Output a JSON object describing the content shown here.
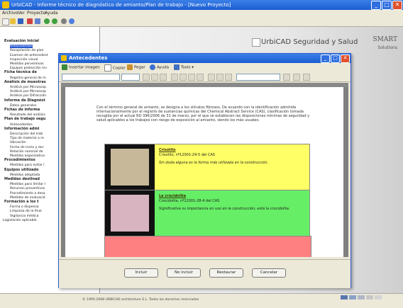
{
  "window": {
    "title": "UrbiCAD - Informe técnico de diagnóstico de amianto/Plan de trabajo - [Nuevo Proyecto]",
    "min": "_",
    "max": "□",
    "close": "✕"
  },
  "menu": [
    "Archivo",
    "Ver",
    "Proyecto",
    "Ayuda"
  ],
  "tree": [
    {
      "label": "Evaluación Inicial",
      "bold": true
    },
    {
      "label": "Antecedentes",
      "selected": true
    },
    {
      "label": "Recopilación de plan"
    },
    {
      "label": "Examen de antecedent"
    },
    {
      "label": "Inspección visual"
    },
    {
      "label": "Medidas perventivas"
    },
    {
      "label": "Equipos protección inv"
    },
    {
      "label": "Ficha técnica de",
      "bold": true
    },
    {
      "label": "Registro general de m"
    },
    {
      "label": "Análisis de muestras",
      "bold": true
    },
    {
      "label": "Análisis por Microscop"
    },
    {
      "label": "Análisis por Microscop"
    },
    {
      "label": "Análisis por Difracción"
    },
    {
      "label": "Informe de Diagnóst",
      "bold": true
    },
    {
      "label": "Datos generales"
    },
    {
      "label": "Fichas de informe",
      "bold": true
    },
    {
      "label": "Resultado del análisis"
    },
    {
      "label": "Plan de trabajo segu",
      "bold": true
    },
    {
      "label": "Antecedentes"
    },
    {
      "label": "Información admi",
      "bold": true
    },
    {
      "label": "Descripción del trab"
    },
    {
      "label": "Tipo de material a re"
    },
    {
      "label": "Ubicación"
    },
    {
      "label": "Fecha de inicio y dur"
    },
    {
      "label": "Relación nominal de"
    },
    {
      "label": "Medidas organizativa"
    },
    {
      "label": "Procedimientos",
      "bold": true
    },
    {
      "label": "Medidas para evitar l"
    },
    {
      "label": "Equipos utilizado",
      "bold": true
    },
    {
      "label": "Medidas adoptada"
    },
    {
      "label": "Medidas destinad",
      "bold": true
    },
    {
      "label": "Medidas para limitar l"
    },
    {
      "label": "Recursos preventivos"
    },
    {
      "label": "Procedimiento a desa"
    },
    {
      "label": "Medidas de evaluació"
    },
    {
      "label": "Formación a los t",
      "bold": true
    },
    {
      "label": "Forma o dispensa"
    },
    {
      "label": "Limpieza de la final"
    },
    {
      "label": "Vigilancia médica"
    },
    {
      "label": "Legislación aplicable"
    }
  ],
  "brand": {
    "name": "UrbiCAD Seguridad y Salud",
    "smart": "SMART",
    "solutions": "Solutions"
  },
  "dialog": {
    "title": "Antecedentes",
    "toolbar": {
      "insert_image": "Insertar imagen",
      "copy": "Copiar",
      "paste": "Pegar",
      "help": "Ayuda",
      "tools": "Tools ▾"
    },
    "intro": "Con el término general de amianto, se designa a los silicatos fibrosos. De acuerdo con la identificación admitida internacionalmente por el registro de sustancias químicas del Chemical Abstract Service (CAS), clasificación tomada recogida por el actual RD 396/2006 de 31 de marzo, por el que se establecen las disposiciones mínimas de seguridad y salud aplicables a los trabajos con riesgo de exposición al amianto, siendo los más usuales:",
    "minerals": [
      {
        "name": "Crisotilo",
        "cas": "Crisotilo, nº12001-29-5 del CAS",
        "desc": "Sin duda alguna es la forma más utilizada en la construcción.",
        "color": "#ffff66",
        "img_color": "#c8b89a"
      },
      {
        "name": "La crocidolita",
        "cas": "Crocidolita, nº12001-28-4 del CAS",
        "desc": "Significativa su importancia en uso en la construcción, está la crocidolita.",
        "color": "#66ee66",
        "img_color": "#d8b4c0"
      }
    ],
    "buttons": {
      "accept": "Incluir",
      "skip": "No incluir",
      "restore": "Restaurar",
      "cancel": "Cancelar"
    }
  },
  "status": {
    "text": "© 1995-2008 URBICAD architecture S.L. Todos los derechos reservados"
  }
}
